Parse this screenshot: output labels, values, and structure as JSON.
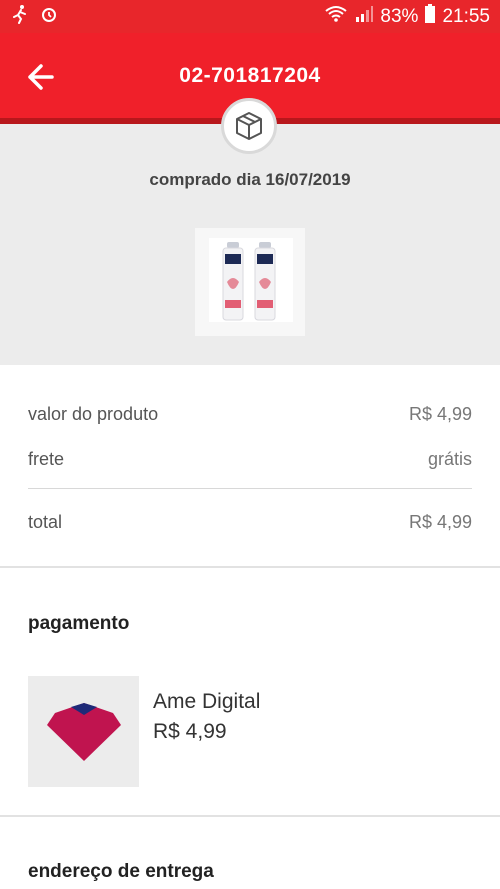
{
  "status_bar": {
    "battery_pct": "83%",
    "time": "21:55",
    "icons": [
      "runner-icon",
      "alarm-icon",
      "wifi-icon",
      "signal-icon",
      "battery-icon"
    ]
  },
  "app_bar": {
    "title": "02-701817204",
    "back_icon": "arrow-left-icon"
  },
  "order": {
    "badge_icon": "package-box-icon",
    "purchase_date": "comprado dia 16/07/2019",
    "product_image": "deodorant-pack-image"
  },
  "summary": {
    "rows": [
      {
        "label": "valor do produto",
        "value": "R$ 4,99"
      },
      {
        "label": "frete",
        "value": "grátis"
      },
      {
        "label": "total",
        "value": "R$ 4,99"
      }
    ]
  },
  "payment": {
    "title": "pagamento",
    "method": "Ame Digital",
    "amount": "R$ 4,99",
    "logo_icon": "ame-digital-logo"
  },
  "delivery": {
    "title": "endereço de entrega"
  },
  "colors": {
    "brand_red": "#f0202a",
    "status_red": "#e8262b",
    "hero_bg": "#ececec"
  }
}
